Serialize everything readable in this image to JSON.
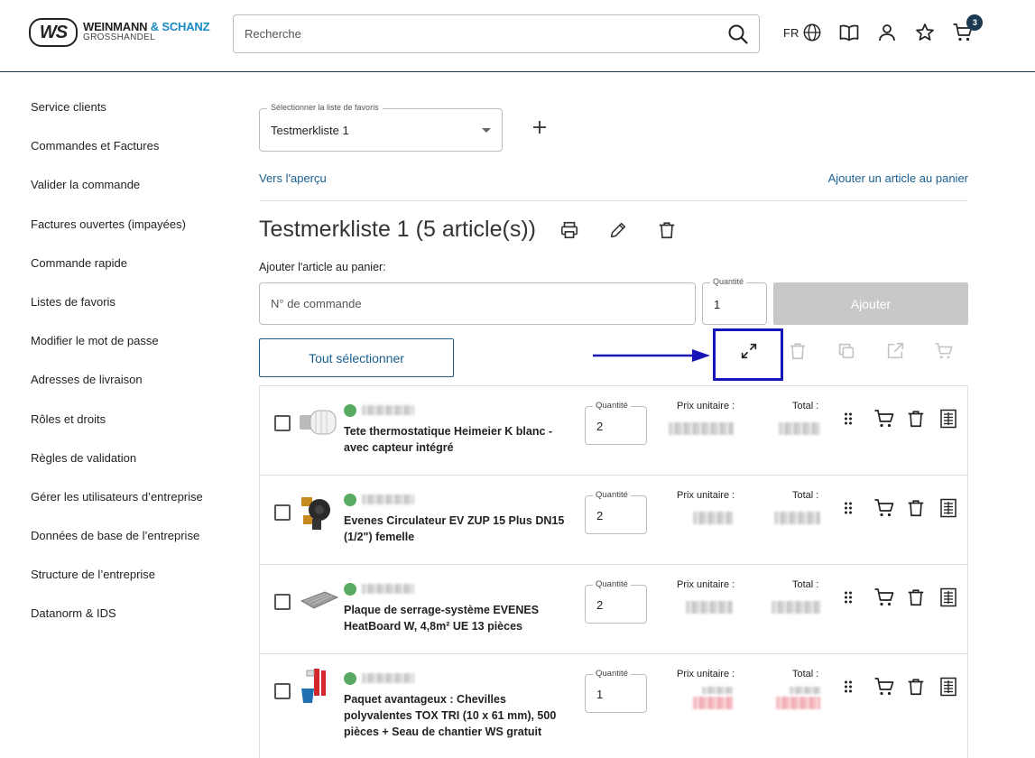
{
  "header": {
    "logo_mark": "WS",
    "logo_name_1": "WEINMANN",
    "logo_name_2": "& SCHANZ",
    "logo_sub": "GROSSHANDEL",
    "search_placeholder": "Recherche",
    "language": "FR",
    "cart_count": "3",
    "icons": [
      "search-icon",
      "globe-icon",
      "catalog-book-icon",
      "user-icon",
      "star-icon",
      "cart-icon"
    ]
  },
  "sidebar": {
    "items": [
      {
        "label": "Service clients"
      },
      {
        "label": "Commandes et Factures"
      },
      {
        "label": "Valider la commande"
      },
      {
        "label": "Factures ouvertes (impayées)"
      },
      {
        "label": "Commande rapide"
      },
      {
        "label": "Listes de favoris"
      },
      {
        "label": "Modifier le mot de passe"
      },
      {
        "label": "Adresses de livraison"
      },
      {
        "label": "Rôles et droits"
      },
      {
        "label": "Règles de validation"
      },
      {
        "label": "Gérer les utilisateurs d’entreprise"
      },
      {
        "label": "Données de base de l’entreprise"
      },
      {
        "label": "Structure de l’entreprise"
      },
      {
        "label": "Datanorm & IDS"
      }
    ]
  },
  "favorites": {
    "select_label": "Sélectionner la liste de favoris",
    "selected": "Testmerkliste 1",
    "link_overview": "Vers l'aperçu",
    "link_add_article": "Ajouter un article au panier",
    "title": "Testmerkliste 1 (5 article(s))",
    "add_label": "Ajouter l'article au panier:",
    "order_placeholder": "N° de commande",
    "qty_label": "Quantité",
    "qty_value": "1",
    "add_button": "Ajouter",
    "select_all": "Tout sélectionner"
  },
  "products": {
    "qty_label": "Quantité",
    "unit_price_label": "Prix unitaire :",
    "total_label": "Total :",
    "items": [
      {
        "name": "Tete thermostatique Heimeier K blanc - avec capteur intégré",
        "qty": "2"
      },
      {
        "name": "Evenes Circulateur EV ZUP 15 Plus DN15 (1/2\") femelle",
        "qty": "2"
      },
      {
        "name": "Plaque de serrage-système EVENES HeatBoard W, 4,8m² UE 13 pièces",
        "qty": "2"
      },
      {
        "name": "Paquet avantageux : Chevilles polyvalentes TOX TRI (10 x 61 mm), 500 pièces + Seau de chantier WS gratuit",
        "qty": "1"
      }
    ]
  },
  "colors": {
    "accent": "#1a5f8f",
    "highlight_annotation": "#1515b8",
    "in_stock": "#5aab62",
    "disabled_button": "#c8c8c8"
  }
}
